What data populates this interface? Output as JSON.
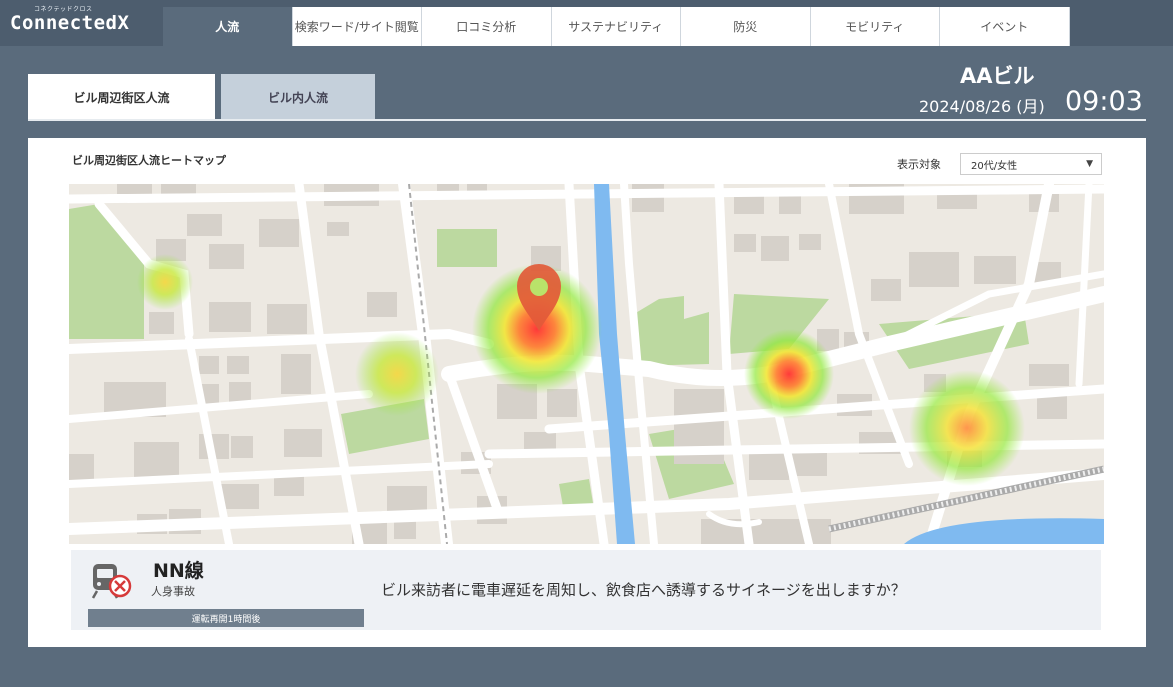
{
  "brand": {
    "small": "コネクテッドクロス",
    "name": "ConnectedX"
  },
  "nav": {
    "tabs": [
      "人流",
      "検索ワード/サイト閲覧",
      "口コミ分析",
      "サステナビリティ",
      "防災",
      "モビリティ",
      "イベント"
    ],
    "active": 0
  },
  "subtabs": [
    "ビル周辺街区人流",
    "ビル内人流"
  ],
  "header": {
    "building": "AAビル",
    "date": "2024/08/26 (月)",
    "time": "09:03"
  },
  "panel": {
    "title": "ビル周辺街区人流ヒートマップ",
    "filter_label": "表示対象",
    "filter_value": "20代/女性"
  },
  "alert": {
    "line": "NN線",
    "cause": "人身事故",
    "resume": "運転再開1時間後",
    "question": "ビル来訪者に電車遅延を周知し、飲食店へ誘導するサイネージを出しますか？"
  },
  "colors": {
    "accent": "#5a6b7c",
    "nav_bg": "#4d5d6e",
    "alert_icon": "#d63a3a"
  },
  "icons": {
    "train": "train-stopped-icon",
    "pin": "map-pin-icon"
  }
}
